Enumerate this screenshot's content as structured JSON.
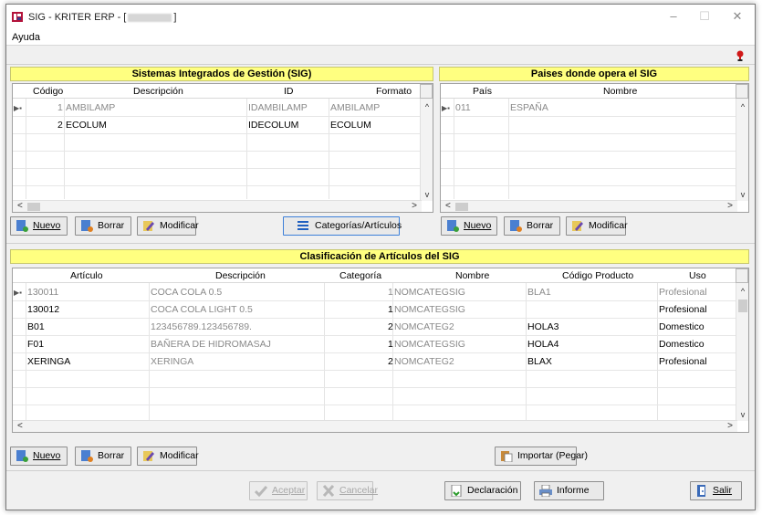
{
  "window": {
    "title_prefix": "SIG - KRITER ERP - [",
    "title_suffix": "]",
    "minimize": "–",
    "maximize": "☐",
    "close": "✕"
  },
  "menu": {
    "help": "Ayuda"
  },
  "sig_panel": {
    "title": "Sistemas Integrados de Gestión (SIG)",
    "columns": [
      "Código",
      "Descripción",
      "ID",
      "Formato"
    ],
    "rows": [
      {
        "code": "1",
        "description": "AMBILAMP",
        "id": "IDAMBILAMP",
        "format": "AMBILAMP"
      },
      {
        "code": "2",
        "description": "ECOLUM",
        "id": "IDECOLUM",
        "format": "ECOLUM"
      }
    ]
  },
  "countries_panel": {
    "title": "Paises donde opera el SIG",
    "columns": [
      "País",
      "Nombre"
    ],
    "rows": [
      {
        "country": "011",
        "name": "ESPAÑA"
      }
    ]
  },
  "articles_panel": {
    "title": "Clasificación de Artículos del SIG",
    "columns": [
      "Artículo",
      "Descripción",
      "Categoría",
      "Nombre",
      "Código Producto",
      "Uso"
    ],
    "rows": [
      {
        "article": "130011",
        "description": "COCA COLA 0.5",
        "category": "1",
        "name": "NOMCATEGSIG",
        "product_code": "BLA1",
        "use": "Profesional"
      },
      {
        "article": "130012",
        "description": "COCA COLA LIGHT 0.5",
        "category": "1",
        "name": "NOMCATEGSIG",
        "product_code": "",
        "use": "Profesional"
      },
      {
        "article": "B01",
        "description": "123456789.123456789.",
        "category": "2",
        "name": "NOMCATEG2",
        "product_code": "HOLA3",
        "use": "Domestico"
      },
      {
        "article": "F01",
        "description": "BAÑERA DE HIDROMASAJ",
        "category": "1",
        "name": "NOMCATEGSIG",
        "product_code": "HOLA4",
        "use": "Domestico"
      },
      {
        "article": "XERINGA",
        "description": "XERINGA",
        "category": "2",
        "name": "NOMCATEG2",
        "product_code": "BLAX",
        "use": "Profesional"
      }
    ]
  },
  "buttons": {
    "new": "Nuevo",
    "delete": "Borrar",
    "modify": "Modificar",
    "categories": "Categorías/Artículos",
    "import": "Importar (Pegar)",
    "accept": "Aceptar",
    "cancel": "Cancelar",
    "declaration": "Declaración",
    "report": "Informe",
    "exit": "Salir"
  },
  "icons": {
    "app": "kriter-app-icon",
    "help": "help-icon",
    "new": "new-document-icon",
    "delete": "delete-icon",
    "modify": "edit-icon",
    "categories": "list-icon",
    "import": "paste-icon",
    "accept": "check-icon",
    "cancel": "x-icon",
    "declaration": "document-arrow-icon",
    "report": "printer-icon",
    "exit": "exit-door-icon"
  },
  "colors": {
    "panel_header": "#ffff80",
    "window_bg": "#f0f0f0"
  }
}
